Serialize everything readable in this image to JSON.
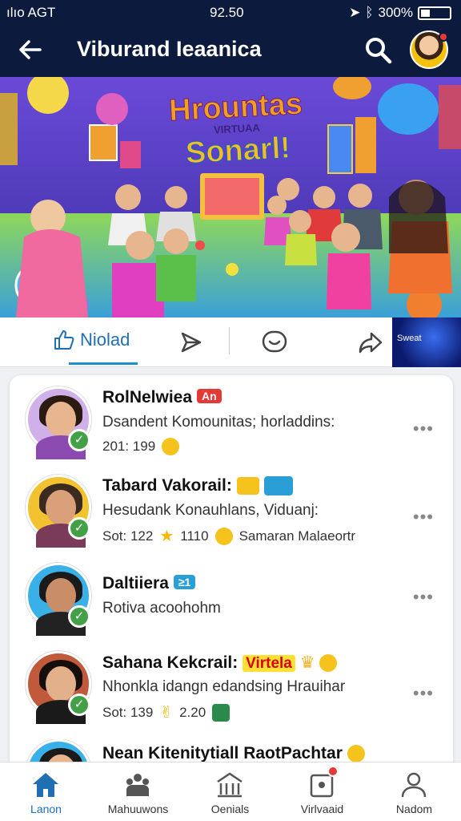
{
  "status": {
    "carrier": "ılıo AGT",
    "time": "92.50",
    "battery": "300%"
  },
  "header": {
    "title": "Viburand Ieaanica"
  },
  "banner": {
    "title_line1": "Hrountas",
    "title_line2": "VIRTUAA",
    "title_line3": "Sonarl!"
  },
  "actions": {
    "like_label": "Niolad",
    "neon_text": "Sweat"
  },
  "posts": [
    {
      "name": "RolNelwiea",
      "badge": "An",
      "text": "Dsandent Komounitas; horladdins:",
      "meta": "201: 199"
    },
    {
      "name": "Tabard Vakorail:",
      "text": "Hesudank Konauhlans, Viduanj:",
      "meta": "Sot: 122",
      "rating": "1110",
      "extra": "Samaran Malaeortr"
    },
    {
      "name": "Daltiiera",
      "badge": "≥1",
      "text": "Rotiva acoohohm"
    },
    {
      "name": "Sahana Kekcrail:",
      "tag": "Virtela",
      "text": "Nhonkla idangn edandsing Hrauihar",
      "meta": "Sot: 139",
      "rating": "2.20"
    },
    {
      "name": "Nean Kitenitytiall RaotPachtar"
    }
  ],
  "bottom_nav": [
    {
      "label": "Lanon"
    },
    {
      "label": "Mahuuwons"
    },
    {
      "label": "Oenials"
    },
    {
      "label": "Virlvaaid"
    },
    {
      "label": "Nadom"
    }
  ],
  "colors": {
    "header_bg": "#0b1a3d",
    "accent": "#1f6fb2",
    "verified": "#43a047"
  }
}
